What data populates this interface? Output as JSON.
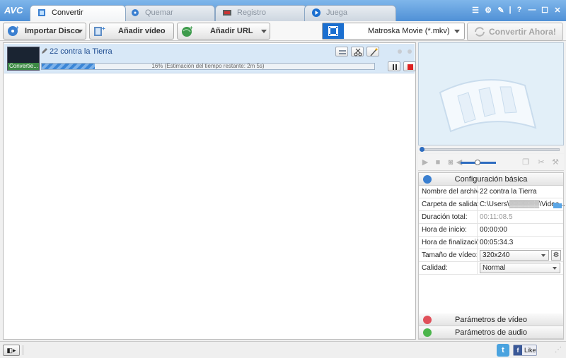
{
  "app": {
    "logo": "AVC"
  },
  "tabs": [
    {
      "label": "Convertir",
      "active": true
    },
    {
      "label": "Quemar",
      "active": false
    },
    {
      "label": "Registro",
      "active": false
    },
    {
      "label": "Juega",
      "active": false
    }
  ],
  "window_icons": [
    "list-icon",
    "gear-icon",
    "wrench-icon",
    "help-icon",
    "minimize-icon",
    "maximize-icon",
    "close-icon"
  ],
  "toolbar": {
    "import_disc": "Importar Disco",
    "add_video": "Añadir vídeo",
    "add_url": "Añadir URL",
    "format": "Matroska Movie (*.mkv)",
    "convert_now": "Convertir Ahora!"
  },
  "file": {
    "name": "22 contra la Tierra",
    "thumb_label": "Convertie...",
    "progress_text": "16% (Estimación del tiempo restante: 2m 5s)",
    "progress_fraction": 0.16
  },
  "settings": {
    "basic_header": "Configuración básica",
    "rows": {
      "filename_key": "Nombre del archivo",
      "filename_val": "22 contra la Tierra",
      "output_key": "Carpeta de salida:",
      "output_val": "C:\\Users\\▒▒▒▒▒▒\\Video...",
      "duration_key": "Duración total:",
      "duration_val": "00:11:08.5",
      "start_key": "Hora de inicio:",
      "start_val": "00:00:00",
      "end_key": "Hora de finalización:",
      "end_val": "00:05:34.3",
      "size_key": "Tamaño de vídeo:",
      "size_val": "320x240",
      "quality_key": "Calidad:",
      "quality_val": "Normal"
    },
    "video_params": "Parámetros de vídeo",
    "audio_params": "Parámetros de audio"
  },
  "status": {
    "twitter": "t",
    "fb_like": "Like",
    "fb_f": "f"
  },
  "colors": {
    "accent": "#1b6fd0",
    "titlebar": "#5a9ad9",
    "row_selected": "#d8e8f7"
  }
}
